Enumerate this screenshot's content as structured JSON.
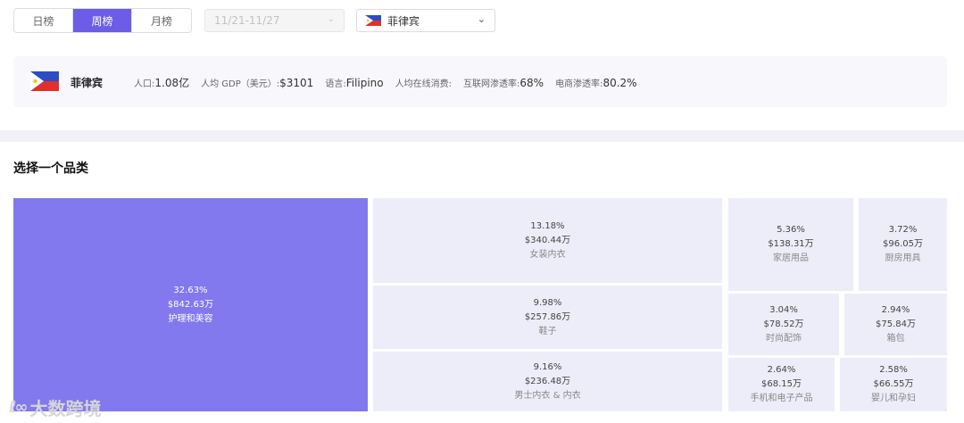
{
  "period_tabs": [
    {
      "label": "日榜",
      "active": false
    },
    {
      "label": "周榜",
      "active": true
    },
    {
      "label": "月榜",
      "active": false
    }
  ],
  "date_range": {
    "value": "11/21-11/27",
    "disabled": true
  },
  "country_select": {
    "value": "菲律宾",
    "flag_icon": "philippines-flag-icon"
  },
  "country_info": {
    "name": "菲律宾",
    "flag_icon": "philippines-flag-icon",
    "stats": [
      {
        "label": "人口:",
        "value": "1.08亿"
      },
      {
        "label": "人均 GDP（美元）:",
        "value": "$3101"
      },
      {
        "label": "语言:",
        "value": "Filipino"
      },
      {
        "label": "人均在线消费:",
        "value": ""
      },
      {
        "label": "互联网渗透率:",
        "value": "68%"
      },
      {
        "label": "电商渗透率:",
        "value": "80.2%"
      }
    ]
  },
  "section_title": "选择一个品类",
  "categories": [
    {
      "pct": "32.63%",
      "amount": "$842.63万",
      "name": "护理和美容",
      "selected": true
    },
    {
      "pct": "13.18%",
      "amount": "$340.44万",
      "name": "女装内衣",
      "selected": false
    },
    {
      "pct": "9.98%",
      "amount": "$257.86万",
      "name": "鞋子",
      "selected": false
    },
    {
      "pct": "9.16%",
      "amount": "$236.48万",
      "name": "男士内衣 & 内衣",
      "selected": false
    },
    {
      "pct": "5.36%",
      "amount": "$138.31万",
      "name": "家居用品",
      "selected": false
    },
    {
      "pct": "3.72%",
      "amount": "$96.05万",
      "name": "厨房用具",
      "selected": false
    },
    {
      "pct": "3.04%",
      "amount": "$78.52万",
      "name": "时尚配饰",
      "selected": false
    },
    {
      "pct": "2.94%",
      "amount": "$75.84万",
      "name": "箱包",
      "selected": false
    },
    {
      "pct": "2.64%",
      "amount": "$68.15万",
      "name": "手机和电子产品",
      "selected": false
    },
    {
      "pct": "2.58%",
      "amount": "$66.55万",
      "name": "婴儿和孕妇",
      "selected": false
    }
  ],
  "watermark": {
    "text": "大数跨境"
  },
  "colors": {
    "accent": "#6c5ce7",
    "selected_tile": "#8279ee",
    "tile": "#ededf9"
  }
}
